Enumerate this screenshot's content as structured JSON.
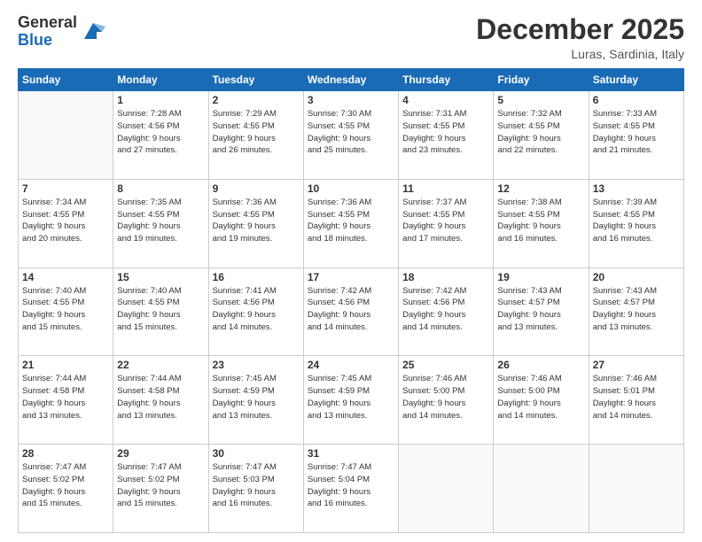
{
  "header": {
    "logo_line1": "General",
    "logo_line2": "Blue",
    "month": "December 2025",
    "location": "Luras, Sardinia, Italy"
  },
  "weekdays": [
    "Sunday",
    "Monday",
    "Tuesday",
    "Wednesday",
    "Thursday",
    "Friday",
    "Saturday"
  ],
  "weeks": [
    [
      {
        "day": "",
        "info": ""
      },
      {
        "day": "1",
        "info": "Sunrise: 7:28 AM\nSunset: 4:56 PM\nDaylight: 9 hours\nand 27 minutes."
      },
      {
        "day": "2",
        "info": "Sunrise: 7:29 AM\nSunset: 4:55 PM\nDaylight: 9 hours\nand 26 minutes."
      },
      {
        "day": "3",
        "info": "Sunrise: 7:30 AM\nSunset: 4:55 PM\nDaylight: 9 hours\nand 25 minutes."
      },
      {
        "day": "4",
        "info": "Sunrise: 7:31 AM\nSunset: 4:55 PM\nDaylight: 9 hours\nand 23 minutes."
      },
      {
        "day": "5",
        "info": "Sunrise: 7:32 AM\nSunset: 4:55 PM\nDaylight: 9 hours\nand 22 minutes."
      },
      {
        "day": "6",
        "info": "Sunrise: 7:33 AM\nSunset: 4:55 PM\nDaylight: 9 hours\nand 21 minutes."
      }
    ],
    [
      {
        "day": "7",
        "info": "Sunrise: 7:34 AM\nSunset: 4:55 PM\nDaylight: 9 hours\nand 20 minutes."
      },
      {
        "day": "8",
        "info": "Sunrise: 7:35 AM\nSunset: 4:55 PM\nDaylight: 9 hours\nand 19 minutes."
      },
      {
        "day": "9",
        "info": "Sunrise: 7:36 AM\nSunset: 4:55 PM\nDaylight: 9 hours\nand 19 minutes."
      },
      {
        "day": "10",
        "info": "Sunrise: 7:36 AM\nSunset: 4:55 PM\nDaylight: 9 hours\nand 18 minutes."
      },
      {
        "day": "11",
        "info": "Sunrise: 7:37 AM\nSunset: 4:55 PM\nDaylight: 9 hours\nand 17 minutes."
      },
      {
        "day": "12",
        "info": "Sunrise: 7:38 AM\nSunset: 4:55 PM\nDaylight: 9 hours\nand 16 minutes."
      },
      {
        "day": "13",
        "info": "Sunrise: 7:39 AM\nSunset: 4:55 PM\nDaylight: 9 hours\nand 16 minutes."
      }
    ],
    [
      {
        "day": "14",
        "info": "Sunrise: 7:40 AM\nSunset: 4:55 PM\nDaylight: 9 hours\nand 15 minutes."
      },
      {
        "day": "15",
        "info": "Sunrise: 7:40 AM\nSunset: 4:55 PM\nDaylight: 9 hours\nand 15 minutes."
      },
      {
        "day": "16",
        "info": "Sunrise: 7:41 AM\nSunset: 4:56 PM\nDaylight: 9 hours\nand 14 minutes."
      },
      {
        "day": "17",
        "info": "Sunrise: 7:42 AM\nSunset: 4:56 PM\nDaylight: 9 hours\nand 14 minutes."
      },
      {
        "day": "18",
        "info": "Sunrise: 7:42 AM\nSunset: 4:56 PM\nDaylight: 9 hours\nand 14 minutes."
      },
      {
        "day": "19",
        "info": "Sunrise: 7:43 AM\nSunset: 4:57 PM\nDaylight: 9 hours\nand 13 minutes."
      },
      {
        "day": "20",
        "info": "Sunrise: 7:43 AM\nSunset: 4:57 PM\nDaylight: 9 hours\nand 13 minutes."
      }
    ],
    [
      {
        "day": "21",
        "info": "Sunrise: 7:44 AM\nSunset: 4:58 PM\nDaylight: 9 hours\nand 13 minutes."
      },
      {
        "day": "22",
        "info": "Sunrise: 7:44 AM\nSunset: 4:58 PM\nDaylight: 9 hours\nand 13 minutes."
      },
      {
        "day": "23",
        "info": "Sunrise: 7:45 AM\nSunset: 4:59 PM\nDaylight: 9 hours\nand 13 minutes."
      },
      {
        "day": "24",
        "info": "Sunrise: 7:45 AM\nSunset: 4:59 PM\nDaylight: 9 hours\nand 13 minutes."
      },
      {
        "day": "25",
        "info": "Sunrise: 7:46 AM\nSunset: 5:00 PM\nDaylight: 9 hours\nand 14 minutes."
      },
      {
        "day": "26",
        "info": "Sunrise: 7:46 AM\nSunset: 5:00 PM\nDaylight: 9 hours\nand 14 minutes."
      },
      {
        "day": "27",
        "info": "Sunrise: 7:46 AM\nSunset: 5:01 PM\nDaylight: 9 hours\nand 14 minutes."
      }
    ],
    [
      {
        "day": "28",
        "info": "Sunrise: 7:47 AM\nSunset: 5:02 PM\nDaylight: 9 hours\nand 15 minutes."
      },
      {
        "day": "29",
        "info": "Sunrise: 7:47 AM\nSunset: 5:02 PM\nDaylight: 9 hours\nand 15 minutes."
      },
      {
        "day": "30",
        "info": "Sunrise: 7:47 AM\nSunset: 5:03 PM\nDaylight: 9 hours\nand 16 minutes."
      },
      {
        "day": "31",
        "info": "Sunrise: 7:47 AM\nSunset: 5:04 PM\nDaylight: 9 hours\nand 16 minutes."
      },
      {
        "day": "",
        "info": ""
      },
      {
        "day": "",
        "info": ""
      },
      {
        "day": "",
        "info": ""
      }
    ]
  ]
}
